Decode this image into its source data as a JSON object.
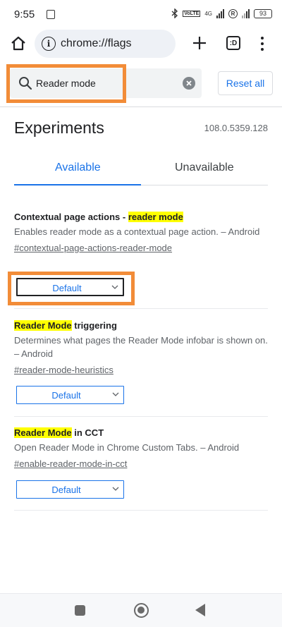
{
  "status": {
    "time": "9:55",
    "network": "4G",
    "battery": "93",
    "r_badge": "R"
  },
  "toolbar": {
    "url": "chrome://flags",
    "tab_count": ":D"
  },
  "search": {
    "value": "Reader mode",
    "reset_label": "Reset all"
  },
  "header": {
    "title": "Experiments",
    "version": "108.0.5359.128"
  },
  "tabs": [
    {
      "label": "Available",
      "selected": true
    },
    {
      "label": "Unavailable",
      "selected": false
    }
  ],
  "experiments": [
    {
      "title_prefix": "Contextual page actions - ",
      "title_highlight": "reader mode",
      "title_suffix": "",
      "description": "Enables reader mode as a contextual page action. – Android",
      "link": "#contextual-page-actions-reader-mode",
      "value": "Default"
    },
    {
      "title_prefix": "",
      "title_highlight": "Reader Mode",
      "title_suffix": " triggering",
      "description": "Determines what pages the Reader Mode infobar is shown on. – Android",
      "link": "#reader-mode-heuristics",
      "value": "Default"
    },
    {
      "title_prefix": "",
      "title_highlight": "Reader Mode",
      "title_suffix": " in CCT",
      "description": "Open Reader Mode in Chrome Custom Tabs. – Android",
      "link": "#enable-reader-mode-in-cct",
      "value": "Default"
    }
  ],
  "colors": {
    "accent": "#1a73e8",
    "highlight": "#ffff00",
    "annotation": "#f28c38"
  }
}
